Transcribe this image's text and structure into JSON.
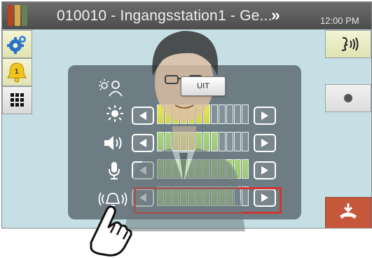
{
  "titlebar": {
    "title": "010010 - Ingangsstation1 - Ge...",
    "time": "12:00 PM",
    "more_icon": "double-chevron-right-icon"
  },
  "sidebar_left": {
    "settings_icon": "gear-icon",
    "alarm_icon": "bell-icon",
    "alarm_badge": "1",
    "keypad_icon": "keypad-icon"
  },
  "sidebar_right": {
    "voice_icon": "speaking-person-icon",
    "record_icon": "record-icon",
    "hangup_icon": "hang-up-icon"
  },
  "overlay": {
    "uit_button_label": "UIT"
  },
  "adjust_panel": {
    "rows": [
      {
        "name": "camera-brightness",
        "icon": "backlight-person-icon",
        "level": null,
        "segments": 0
      },
      {
        "name": "brightness",
        "icon": "sun-icon",
        "level": 7,
        "segments": 12,
        "color": "#e9e84a"
      },
      {
        "name": "speaker-volume",
        "icon": "speaker-icon",
        "level": 8,
        "segments": 12,
        "color": "#a9d77a"
      },
      {
        "name": "microphone-volume",
        "icon": "microphone-icon",
        "level": 12,
        "segments": 12,
        "color": "#a9d77a"
      },
      {
        "name": "call-tone-volume",
        "icon": "ringing-bell-icon",
        "level": 10,
        "segments": 12,
        "color": "#a9d77a",
        "highlighted": true
      }
    ]
  }
}
